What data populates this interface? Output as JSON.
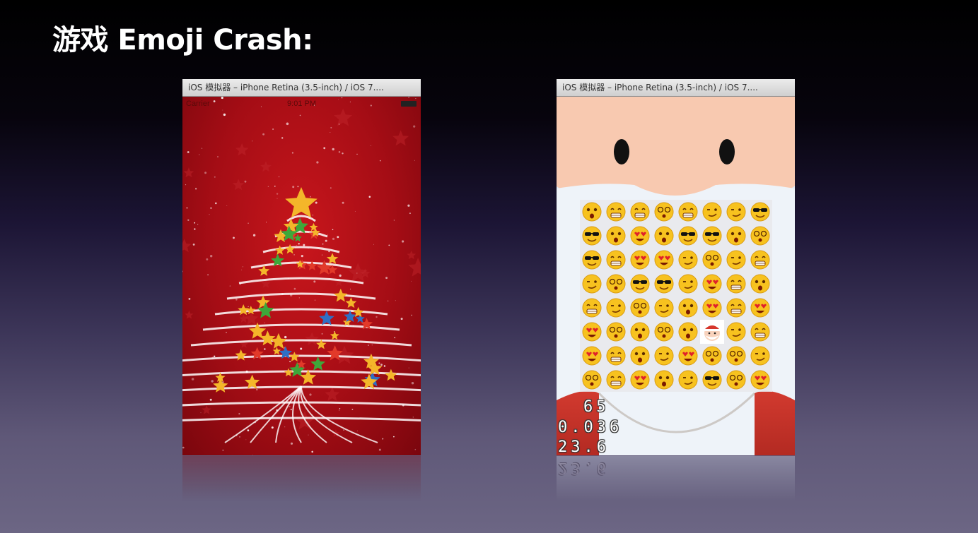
{
  "slide": {
    "title": "游戏 Emoji Crash:"
  },
  "left_window": {
    "title": "iOS 模拟器 – iPhone Retina (3.5-inch) / iOS 7....",
    "status": {
      "carrier": "Carrier",
      "time": "9:01 PM"
    }
  },
  "right_window": {
    "title": "iOS 模拟器 – iPhone Retina (3.5-inch) / iOS 7....",
    "hud": {
      "line1": "65",
      "line2": "0.036",
      "line3": "23.6"
    },
    "grid": [
      [
        "surprised",
        "grin",
        "grin",
        "dizzy",
        "grin",
        "wink",
        "wink",
        "cool"
      ],
      [
        "cool",
        "surprised",
        "heart-eyes",
        "surprised",
        "cool",
        "cool",
        "surprised",
        "dizzy"
      ],
      [
        "cool",
        "grin",
        "heart-eyes",
        "heart-eyes",
        "wink",
        "dizzy",
        "wink",
        "grin"
      ],
      [
        "wink",
        "dizzy",
        "cool",
        "cool",
        "wink",
        "heart-eyes",
        "grin",
        "surprised"
      ],
      [
        "grin",
        "wink",
        "dizzy",
        "wink",
        "surprised",
        "heart-eyes",
        "grin",
        "heart-eyes"
      ],
      [
        "heart-eyes",
        "dizzy",
        "surprised",
        "dizzy",
        "surprised",
        "santa",
        "wink",
        "grin"
      ],
      [
        "heart-eyes",
        "grin",
        "surprised",
        "wink",
        "heart-eyes",
        "dizzy",
        "dizzy",
        "wink"
      ],
      [
        "dizzy",
        "grin",
        "heart-eyes",
        "surprised",
        "wink",
        "cool",
        "dizzy",
        "heart-eyes"
      ]
    ]
  },
  "colors": {
    "xmas_red": "#b5121b",
    "star_gold": "#f4b62a",
    "emoji_yellow": "#f7c21f",
    "santa_face": "#f8c9b0",
    "santa_coat": "#c9362c"
  }
}
